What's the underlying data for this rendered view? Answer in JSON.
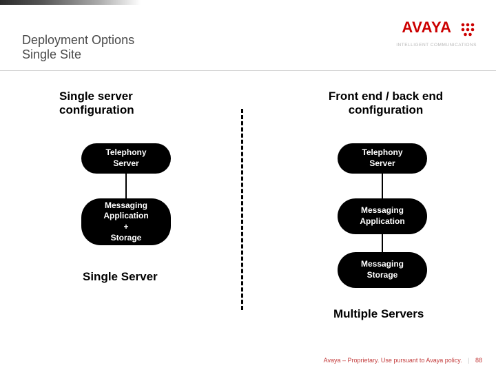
{
  "brand": {
    "name": "AVAYA",
    "tagline": "INTELLIGENT COMMUNICATIONS",
    "red": "#c00"
  },
  "title": {
    "line1": "Deployment Options",
    "line2": "Single Site"
  },
  "left": {
    "heading1": "Single server",
    "heading2": "configuration",
    "box1_l1": "Telephony",
    "box1_l2": "Server",
    "box2_l1": "Messaging",
    "box2_l2": "Application",
    "box2_l3": "+",
    "box2_l4": "Storage",
    "caption": "Single Server"
  },
  "right": {
    "heading1": "Front end / back end",
    "heading2": "configuration",
    "box1_l1": "Telephony",
    "box1_l2": "Server",
    "box2_l1": "Messaging",
    "box2_l2": "Application",
    "box3_l1": "Messaging",
    "box3_l2": "Storage",
    "caption": "Multiple Servers"
  },
  "footer": {
    "text": "Avaya – Proprietary. Use pursuant to Avaya policy.",
    "page": "88"
  }
}
